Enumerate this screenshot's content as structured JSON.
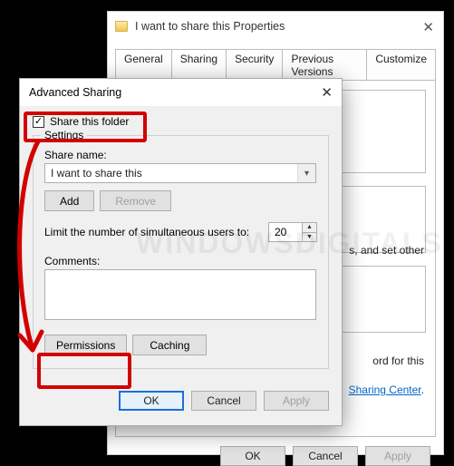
{
  "properties": {
    "title": "I want to share this Properties",
    "tabs": [
      "General",
      "Sharing",
      "Security",
      "Previous Versions",
      "Customize"
    ],
    "active_tab_index": 1,
    "snippet1": "s, and set other",
    "snippet2": "ord for this",
    "link_text": "Sharing Center",
    "link_suffix": ".",
    "buttons": {
      "ok": "OK",
      "cancel": "Cancel",
      "apply": "Apply"
    }
  },
  "advanced": {
    "title": "Advanced Sharing",
    "share_checkbox_label": "Share this folder",
    "share_checked": true,
    "group_label": "Settings",
    "share_name_label": "Share name:",
    "share_name_value": "I want to share this",
    "add": "Add",
    "remove": "Remove",
    "limit_label": "Limit the number of simultaneous users to:",
    "limit_value": "20",
    "comments_label": "Comments:",
    "comments_value": "",
    "permissions": "Permissions",
    "caching": "Caching",
    "buttons": {
      "ok": "OK",
      "cancel": "Cancel",
      "apply": "Apply"
    }
  }
}
